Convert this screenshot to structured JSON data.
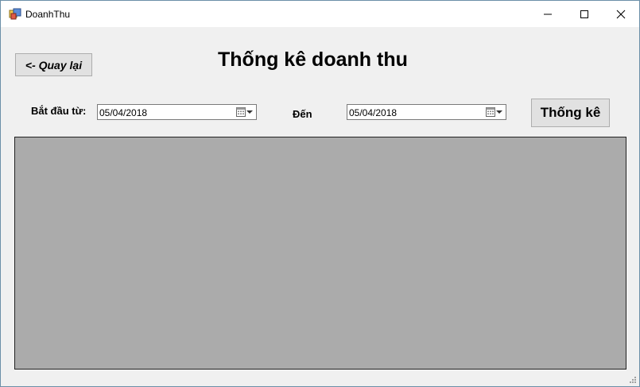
{
  "window": {
    "title": "DoanhThu",
    "app_icon": "form-icon",
    "controls": [
      "minimize-icon",
      "maximize-icon",
      "close-icon"
    ]
  },
  "toolbar": {
    "back_label": "<- Quay lại"
  },
  "heading": "Thống kê doanh thu",
  "filters": {
    "start_label": "Bắt đầu từ:",
    "start_value": "05/04/2018",
    "end_label": "Đến",
    "end_value": "05/04/2018",
    "submit_label": "Thống kê"
  },
  "colors": {
    "window_bg": "#f0f0f0",
    "grid_bg": "#ababab",
    "button_bg": "#e1e1e1"
  }
}
